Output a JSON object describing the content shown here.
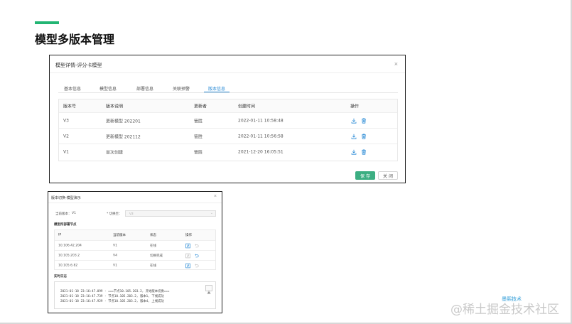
{
  "slide": {
    "title": "模型多版本管理",
    "accent_color": "#22b573"
  },
  "dialog1": {
    "title": "模型详情-评分卡模型",
    "close_glyph": "×",
    "tabs": [
      {
        "label": "基本信息",
        "active": false
      },
      {
        "label": "模型信息",
        "active": false
      },
      {
        "label": "部署信息",
        "active": false
      },
      {
        "label": "关联预警",
        "active": false
      },
      {
        "label": "版本信息",
        "active": true
      }
    ],
    "columns": [
      "版本号",
      "版本说明",
      "更新者",
      "创建时间",
      "操作"
    ],
    "rows": [
      {
        "version": "V3",
        "desc": "更新模型 202201",
        "updater": "管胜",
        "created": "2022-01-11 10:58:48"
      },
      {
        "version": "V2",
        "desc": "更新模型 202112",
        "updater": "管胜",
        "created": "2022-01-11 10:56:58"
      },
      {
        "version": "V1",
        "desc": "首次创建",
        "updater": "管胜",
        "created": "2021-12-20 16:05:51"
      }
    ],
    "row_actions": [
      "download-icon",
      "delete-icon"
    ],
    "save_label": "保 存",
    "close_label": "关 闭",
    "accent_color": "#3cae82",
    "link_color": "#2a8bd6"
  },
  "dialog2": {
    "title": "版本切换-模型演示",
    "close_glyph": "×",
    "current_version_label": "当前版本：",
    "current_version_value": "V1",
    "switch_to_label": "* 切换至：",
    "switch_to_value": "V3",
    "nodes_section": "模型所部署节点",
    "columns": [
      "IP",
      "当前版本",
      "状态",
      "操作"
    ],
    "rows": [
      {
        "ip": "10.106.42.204",
        "version": "V1",
        "status": "在线"
      },
      {
        "ip": "10.105.203.2",
        "version": "V4",
        "status": "切换完成"
      },
      {
        "ip": "10.105.6.82",
        "version": "V1",
        "status": "在线"
      }
    ],
    "log_section": "实时日志",
    "log_lines": [
      "2021-01-18 23:16:47.099 - ===节点10.105.203.2, 开始版本切换===",
      "2021-01-18 23:16:47.739 - 节点10.105.203.2, 版本1, 下线成功",
      "2021-01-18 23:16:47.929 - 节点10.105.203.2, 版本4, 上线成功"
    ]
  },
  "watermark": {
    "logo_text": "墨熙技术",
    "text": "@稀土掘金技术社区"
  }
}
